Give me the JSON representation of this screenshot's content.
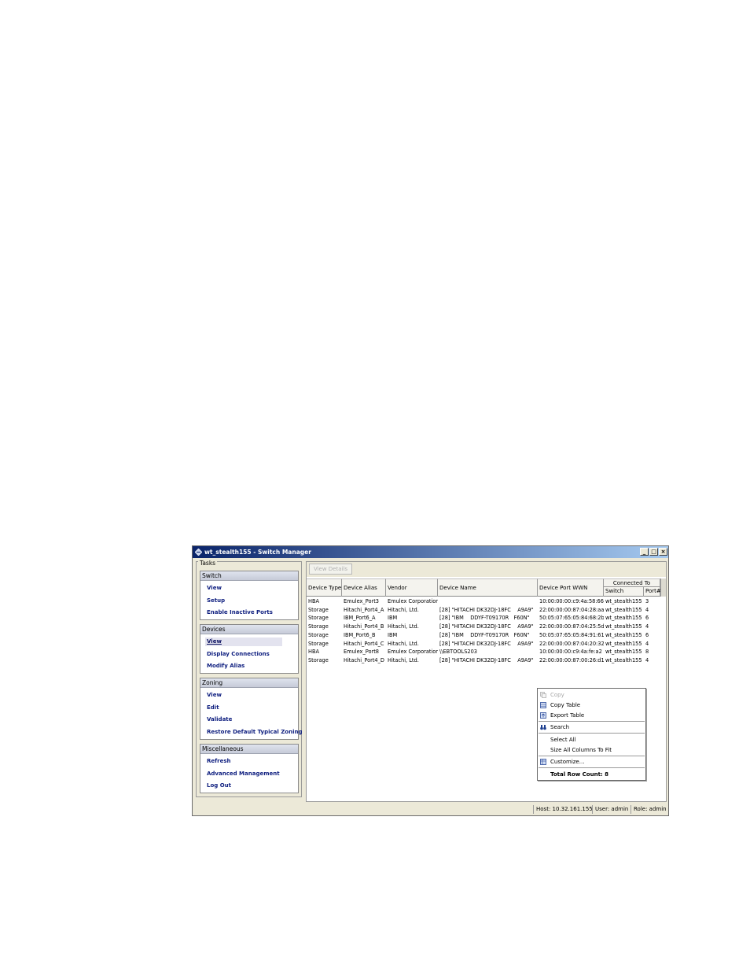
{
  "window": {
    "title": "wt_stealth155 - Switch Manager",
    "controls": [
      "_",
      "□",
      "×"
    ]
  },
  "tasks": {
    "label": "Tasks",
    "panels": [
      {
        "title": "Switch",
        "links": [
          "View",
          "Setup",
          "Enable Inactive Ports"
        ]
      },
      {
        "title": "Devices",
        "links": [
          "View",
          "Display Connections",
          "Modify Alias"
        ]
      },
      {
        "title": "Zoning",
        "links": [
          "View",
          "Edit",
          "Validate",
          "Restore Default Typical Zoning"
        ]
      },
      {
        "title": "Miscellaneous",
        "links": [
          "Refresh",
          "Advanced Management",
          "Log Out"
        ]
      }
    ],
    "current": "Devices / View"
  },
  "toolbar": {
    "view_details": "View Details"
  },
  "table": {
    "columns": {
      "device_type": "Device Type",
      "device_alias": "Device Alias",
      "vendor": "Vendor",
      "device_name": "Device Name",
      "device_port_wwn": "Device Port WWN",
      "connected_to": "Connected To",
      "switch": "Switch",
      "port": "Port#"
    },
    "rows": [
      [
        "HBA",
        "Emulex_Port3",
        "Emulex Corporation",
        "",
        "10:00:00:00:c9:4a:58:66",
        "wt_stealth155",
        "3"
      ],
      [
        "Storage",
        "Hitachi_Port4_A",
        "Hitachi, Ltd.",
        "[28] \"HITACHI DK32DJ-18FC    A9A9\"",
        "22:00:00:00:87:04:28:aa",
        "wt_stealth155",
        "4"
      ],
      [
        "Storage",
        "IBM_Port6_A",
        "IBM",
        "[28] \"IBM    DDYF-T09170R   F60N\"",
        "50:05:07:65:05:84:68:2b",
        "wt_stealth155",
        "6"
      ],
      [
        "Storage",
        "Hitachi_Port4_B",
        "Hitachi, Ltd.",
        "[28] \"HITACHI DK32DJ-18FC    A9A9\"",
        "22:00:00:00:87:04:25:5d",
        "wt_stealth155",
        "4"
      ],
      [
        "Storage",
        "IBM_Port6_B",
        "IBM",
        "[28] \"IBM    DDYF-T09170R   F60N\"",
        "50:05:07:65:05:84:91:61",
        "wt_stealth155",
        "6"
      ],
      [
        "Storage",
        "Hitachi_Port4_C",
        "Hitachi, Ltd.",
        "[28] \"HITACHI DK32DJ-18FC    A9A9\"",
        "22:00:00:00:87:04:20:32",
        "wt_stealth155",
        "4"
      ],
      [
        "HBA",
        "Emulex_Port8",
        "Emulex Corporation",
        "\\\\EBTOOLS203",
        "10:00:00:00:c9:4a:fe:a2",
        "wt_stealth155",
        "8"
      ],
      [
        "Storage",
        "Hitachi_Port4_D",
        "Hitachi, Ltd.",
        "[28] \"HITACHI DK32DJ-18FC    A9A9\"",
        "22:00:00:00:87:00:26:d1",
        "wt_stealth155",
        "4"
      ]
    ]
  },
  "context_menu": {
    "copy": "Copy",
    "copy_table": "Copy Table",
    "export_table": "Export Table",
    "search": "Search",
    "select_all": "Select All",
    "size_columns": "Size All Columns To Fit",
    "customize": "Customize...",
    "total_row_count": "Total Row Count: 8"
  },
  "status": {
    "host": "Host: 10.32.161.155",
    "user": "User: admin",
    "role": "Role: admin"
  },
  "icons": {
    "app": "switch-app-icon",
    "copy": "copy-icon",
    "copy_table": "copy-table-icon",
    "export_table": "export-table-icon",
    "search": "binoculars-icon",
    "customize": "customize-table-icon"
  },
  "colors": {
    "title_start": "#0a246a",
    "title_end": "#a6caf0",
    "link": "#102080",
    "window_bg": "#ece9d8"
  }
}
